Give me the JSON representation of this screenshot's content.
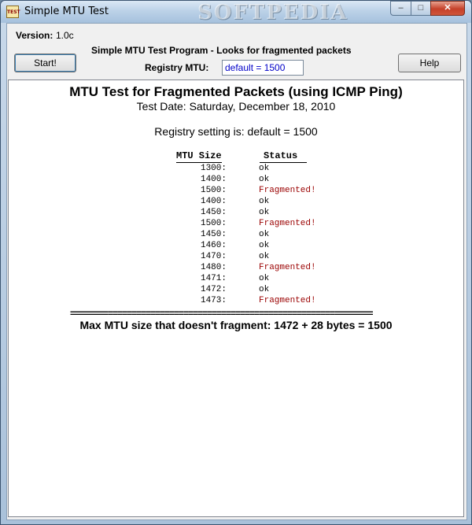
{
  "window": {
    "title": "Simple MTU Test",
    "icon_text": "TEST",
    "watermark": "SOFTPEDIA",
    "min_glyph": "–",
    "max_glyph": "□",
    "close_glyph": "✕"
  },
  "header": {
    "version_label": "Version:",
    "version_value": "1.0c",
    "heading": "Simple MTU Test Program - Looks for fragmented packets",
    "registry_label": "Registry MTU:",
    "registry_value": "default = 1500",
    "start_label": "Start!",
    "help_label": "Help"
  },
  "output": {
    "title": "MTU Test for Fragmented Packets (using ICMP Ping)",
    "date_line": "Test Date: Saturday, December 18, 2010",
    "registry_line": "Registry setting is: default = 1500",
    "col_size": "MTU Size",
    "col_status": "Status",
    "rows": [
      {
        "size": "1300:",
        "status": "ok",
        "fragmented": false
      },
      {
        "size": "1400:",
        "status": "ok",
        "fragmented": false
      },
      {
        "size": "1500:",
        "status": "Fragmented!",
        "fragmented": true
      },
      {
        "size": "1400:",
        "status": "ok",
        "fragmented": false
      },
      {
        "size": "1450:",
        "status": "ok",
        "fragmented": false
      },
      {
        "size": "1500:",
        "status": "Fragmented!",
        "fragmented": true
      },
      {
        "size": "1450:",
        "status": "ok",
        "fragmented": false
      },
      {
        "size": "1460:",
        "status": "ok",
        "fragmented": false
      },
      {
        "size": "1470:",
        "status": "ok",
        "fragmented": false
      },
      {
        "size": "1480:",
        "status": "Fragmented!",
        "fragmented": true
      },
      {
        "size": "1471:",
        "status": "ok",
        "fragmented": false
      },
      {
        "size": "1472:",
        "status": "ok",
        "fragmented": false
      },
      {
        "size": "1473:",
        "status": "Fragmented!",
        "fragmented": true
      }
    ],
    "separator": "================================================================",
    "summary": "Max MTU size that doesn't fragment: 1472 + 28 bytes = 1500"
  }
}
